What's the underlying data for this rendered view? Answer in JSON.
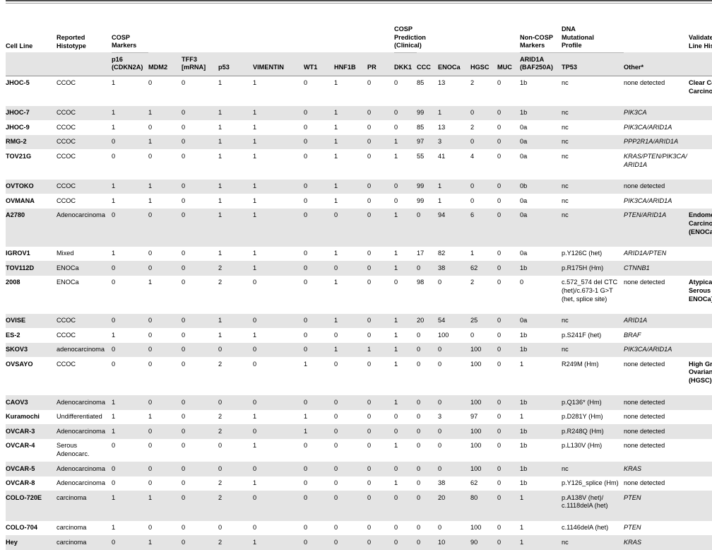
{
  "table": {
    "group_headers": {
      "cell_line": "Cell Line",
      "reported_histotype": "Reported\nHistotype",
      "cosp_markers": "COSP\nMarkers",
      "cosp_prediction": "COSP Prediction\n(Clinical)",
      "non_cosp_markers": "Non-COSP\nMarkers",
      "dna_mutational_profile": "DNA\nMutational\nProfile",
      "validated_histotype": "Validated Cell\nLine HistoType"
    },
    "sub_headers": {
      "p16": "p16\n(CDKN2A)",
      "mdm2": "MDM2",
      "tff3": "TFF3\n[mRNA]",
      "p53": "p53",
      "vimentin": "VIMENTIN",
      "wt1": "WT1",
      "hnf1b": "HNF1B",
      "pr": "PR",
      "dkk1": "DKK1",
      "ccc": "CCC",
      "enoca": "ENOCa",
      "hgsc": "HGSC",
      "muc": "MUC",
      "arid1a": "ARID1A\n(BAF250A)",
      "tp53": "TP53",
      "other": "Other*"
    },
    "rows": [
      {
        "cell_line": "JHOC-5",
        "histotype": "CCOC",
        "p16": "1",
        "mdm2": "0",
        "tff3": "0",
        "p53": "1",
        "vimentin": "1",
        "wt1": "0",
        "hnf1b": "1",
        "pr": "0",
        "dkk1": "0",
        "ccc": "85",
        "enoca": "13",
        "hgsc": "2",
        "muc": "0",
        "arid1a": "1b",
        "tp53": "nc",
        "other": "none detected",
        "other_italic": false,
        "validated": "Clear Cell Carcinoma (CCC)",
        "shaded": false,
        "tall": true
      },
      {
        "cell_line": "JHOC-7",
        "histotype": "CCOC",
        "p16": "1",
        "mdm2": "1",
        "tff3": "0",
        "p53": "1",
        "vimentin": "1",
        "wt1": "0",
        "hnf1b": "1",
        "pr": "0",
        "dkk1": "0",
        "ccc": "99",
        "enoca": "1",
        "hgsc": "0",
        "muc": "0",
        "arid1a": "1b",
        "tp53": "nc",
        "other": "PIK3CA",
        "other_italic": true,
        "validated": "",
        "shaded": true,
        "tall": false
      },
      {
        "cell_line": "JHOC-9",
        "histotype": "CCOC",
        "p16": "1",
        "mdm2": "0",
        "tff3": "0",
        "p53": "1",
        "vimentin": "1",
        "wt1": "0",
        "hnf1b": "1",
        "pr": "0",
        "dkk1": "0",
        "ccc": "85",
        "enoca": "13",
        "hgsc": "2",
        "muc": "0",
        "arid1a": "0a",
        "tp53": "nc",
        "other": "PIK3CA/ARID1A",
        "other_italic": true,
        "validated": "",
        "shaded": false,
        "tall": false
      },
      {
        "cell_line": "RMG-2",
        "histotype": "CCOC",
        "p16": "0",
        "mdm2": "1",
        "tff3": "0",
        "p53": "1",
        "vimentin": "1",
        "wt1": "0",
        "hnf1b": "1",
        "pr": "0",
        "dkk1": "1",
        "ccc": "97",
        "enoca": "3",
        "hgsc": "0",
        "muc": "0",
        "arid1a": "0a",
        "tp53": "nc",
        "other": "PPP2R1A/ARID1A",
        "other_italic": true,
        "validated": "",
        "shaded": true,
        "tall": false
      },
      {
        "cell_line": "TOV21G",
        "histotype": "CCOC",
        "p16": "0",
        "mdm2": "0",
        "tff3": "0",
        "p53": "1",
        "vimentin": "1",
        "wt1": "0",
        "hnf1b": "1",
        "pr": "0",
        "dkk1": "1",
        "ccc": "55",
        "enoca": "41",
        "hgsc": "4",
        "muc": "0",
        "arid1a": "0a",
        "tp53": "nc",
        "other": "KRAS/PTEN/PIK3CA/ ARID1A",
        "other_italic": true,
        "validated": "",
        "shaded": false,
        "tall": true
      },
      {
        "cell_line": "OVTOKO",
        "histotype": "CCOC",
        "p16": "1",
        "mdm2": "1",
        "tff3": "0",
        "p53": "1",
        "vimentin": "1",
        "wt1": "0",
        "hnf1b": "1",
        "pr": "0",
        "dkk1": "0",
        "ccc": "99",
        "enoca": "1",
        "hgsc": "0",
        "muc": "0",
        "arid1a": "0b",
        "tp53": "nc",
        "other": "none detected",
        "other_italic": false,
        "validated": "",
        "shaded": true,
        "tall": false
      },
      {
        "cell_line": "OVMANA",
        "histotype": "CCOC",
        "p16": "1",
        "mdm2": "1",
        "tff3": "0",
        "p53": "1",
        "vimentin": "1",
        "wt1": "0",
        "hnf1b": "1",
        "pr": "0",
        "dkk1": "0",
        "ccc": "99",
        "enoca": "1",
        "hgsc": "0",
        "muc": "0",
        "arid1a": "0a",
        "tp53": "nc",
        "other": "PIK3CA/ARID1A",
        "other_italic": true,
        "validated": "",
        "shaded": false,
        "tall": false
      },
      {
        "cell_line": "A2780",
        "histotype": "Adenocarcinoma",
        "p16": "0",
        "mdm2": "0",
        "tff3": "0",
        "p53": "1",
        "vimentin": "1",
        "wt1": "0",
        "hnf1b": "0",
        "pr": "0",
        "dkk1": "1",
        "ccc": "0",
        "enoca": "94",
        "hgsc": "6",
        "muc": "0",
        "arid1a": "0a",
        "tp53": "nc",
        "other": "PTEN/ARID1A",
        "other_italic": true,
        "validated": "Endometrioid Carcinoma (ENOCa)",
        "shaded": true,
        "tall": true
      },
      {
        "cell_line": "IGROV1",
        "histotype": "Mixed",
        "p16": "1",
        "mdm2": "0",
        "tff3": "0",
        "p53": "1",
        "vimentin": "1",
        "wt1": "0",
        "hnf1b": "1",
        "pr": "0",
        "dkk1": "1",
        "ccc": "17",
        "enoca": "82",
        "hgsc": "1",
        "muc": "0",
        "arid1a": "0a",
        "tp53": "p.Y126C (het)",
        "other": "ARID1A/PTEN",
        "other_italic": true,
        "validated": "",
        "shaded": false,
        "tall": false
      },
      {
        "cell_line": "TOV112D",
        "histotype": "ENOCa",
        "p16": "0",
        "mdm2": "0",
        "tff3": "0",
        "p53": "2",
        "vimentin": "1",
        "wt1": "0",
        "hnf1b": "0",
        "pr": "0",
        "dkk1": "1",
        "ccc": "0",
        "enoca": "38",
        "hgsc": "62",
        "muc": "0",
        "arid1a": "1b",
        "tp53": "p.R175H (Hm)",
        "other": "CTNNB1",
        "other_italic": true,
        "validated": "",
        "shaded": true,
        "tall": false
      },
      {
        "cell_line": "2008",
        "histotype": "ENOCa",
        "p16": "0",
        "mdm2": "1",
        "tff3": "0",
        "p53": "2",
        "vimentin": "0",
        "wt1": "0",
        "hnf1b": "1",
        "pr": "0",
        "dkk1": "0",
        "ccc": "98",
        "enoca": "0",
        "hgsc": "2",
        "muc": "0",
        "arid1a": "0",
        "tp53": "c.572_574 del CTC (het)/c.673-1 G>T (het, splice site)",
        "other": "none detected",
        "other_italic": false,
        "validated": "Atypical Non-Serous [CCC/ ENOCa] cell lines**",
        "shaded": false,
        "tall": true
      },
      {
        "cell_line": "OVISE",
        "histotype": "CCOC",
        "p16": "0",
        "mdm2": "0",
        "tff3": "0",
        "p53": "1",
        "vimentin": "0",
        "wt1": "0",
        "hnf1b": "1",
        "pr": "0",
        "dkk1": "1",
        "ccc": "20",
        "enoca": "54",
        "hgsc": "25",
        "muc": "0",
        "arid1a": "0a",
        "tp53": "nc",
        "other": "ARID1A",
        "other_italic": true,
        "validated": "",
        "shaded": true,
        "tall": false
      },
      {
        "cell_line": "ES-2",
        "histotype": "CCOC",
        "p16": "1",
        "mdm2": "0",
        "tff3": "0",
        "p53": "1",
        "vimentin": "1",
        "wt1": "0",
        "hnf1b": "0",
        "pr": "0",
        "dkk1": "1",
        "ccc": "0",
        "enoca": "100",
        "hgsc": "0",
        "muc": "0",
        "arid1a": "1b",
        "tp53": "p.S241F (het)",
        "other": "BRAF",
        "other_italic": true,
        "validated": "",
        "shaded": false,
        "tall": false
      },
      {
        "cell_line": "SKOV3",
        "histotype": "adenocarcinoma",
        "p16": "0",
        "mdm2": "0",
        "tff3": "0",
        "p53": "0",
        "vimentin": "0",
        "wt1": "0",
        "hnf1b": "1",
        "pr": "1",
        "dkk1": "1",
        "ccc": "0",
        "enoca": "0",
        "hgsc": "100",
        "muc": "0",
        "arid1a": "1b",
        "tp53": "nc",
        "other": "PIK3CA/ARID1A",
        "other_italic": true,
        "validated": "",
        "shaded": true,
        "tall": false
      },
      {
        "cell_line": "OVSAYO",
        "histotype": "CCOC",
        "p16": "0",
        "mdm2": "0",
        "tff3": "0",
        "p53": "2",
        "vimentin": "0",
        "wt1": "1",
        "hnf1b": "0",
        "pr": "0",
        "dkk1": "1",
        "ccc": "0",
        "enoca": "0",
        "hgsc": "100",
        "muc": "0",
        "arid1a": "1",
        "tp53": "R249M (Hm)",
        "other": "none detected",
        "other_italic": false,
        "validated": "High Grade Serous Ovarian Carcinoma (HGSC)",
        "shaded": false,
        "tall": true
      },
      {
        "cell_line": "CAOV3",
        "histotype": "Adenocarcinoma",
        "p16": "1",
        "mdm2": "0",
        "tff3": "0",
        "p53": "0",
        "vimentin": "0",
        "wt1": "0",
        "hnf1b": "0",
        "pr": "0",
        "dkk1": "1",
        "ccc": "0",
        "enoca": "0",
        "hgsc": "100",
        "muc": "0",
        "arid1a": "1b",
        "tp53": "p.Q136* (Hm)",
        "other": "none detected",
        "other_italic": false,
        "validated": "",
        "shaded": true,
        "tall": false
      },
      {
        "cell_line": "Kuramochi",
        "histotype": "Undifferentiated",
        "p16": "1",
        "mdm2": "1",
        "tff3": "0",
        "p53": "2",
        "vimentin": "1",
        "wt1": "1",
        "hnf1b": "0",
        "pr": "0",
        "dkk1": "0",
        "ccc": "0",
        "enoca": "3",
        "hgsc": "97",
        "muc": "0",
        "arid1a": "1",
        "tp53": "p.D281Y (Hm)",
        "other": "none detected",
        "other_italic": false,
        "validated": "",
        "shaded": false,
        "tall": false
      },
      {
        "cell_line": "OVCAR-3",
        "histotype": "Adenocarcinoma",
        "p16": "1",
        "mdm2": "0",
        "tff3": "0",
        "p53": "2",
        "vimentin": "0",
        "wt1": "1",
        "hnf1b": "0",
        "pr": "0",
        "dkk1": "0",
        "ccc": "0",
        "enoca": "0",
        "hgsc": "100",
        "muc": "0",
        "arid1a": "1b",
        "tp53": "p.R248Q (Hm)",
        "other": "none detected",
        "other_italic": false,
        "validated": "",
        "shaded": true,
        "tall": false
      },
      {
        "cell_line": "OVCAR-4",
        "histotype": "Serous Adenocarc.",
        "p16": "0",
        "mdm2": "0",
        "tff3": "0",
        "p53": "0",
        "vimentin": "1",
        "wt1": "0",
        "hnf1b": "0",
        "pr": "0",
        "dkk1": "1",
        "ccc": "0",
        "enoca": "0",
        "hgsc": "100",
        "muc": "0",
        "arid1a": "1b",
        "tp53": "p.L130V (Hm)",
        "other": "none detected",
        "other_italic": false,
        "validated": "",
        "shaded": false,
        "tall": false
      },
      {
        "cell_line": "OVCAR-5",
        "histotype": "Adenocarcinoma",
        "p16": "0",
        "mdm2": "0",
        "tff3": "0",
        "p53": "0",
        "vimentin": "0",
        "wt1": "0",
        "hnf1b": "0",
        "pr": "0",
        "dkk1": "0",
        "ccc": "0",
        "enoca": "0",
        "hgsc": "100",
        "muc": "0",
        "arid1a": "1b",
        "tp53": "nc",
        "other": "KRAS",
        "other_italic": true,
        "validated": "",
        "shaded": true,
        "tall": false
      },
      {
        "cell_line": "OVCAR-8",
        "histotype": "Adenocarcinoma",
        "p16": "0",
        "mdm2": "0",
        "tff3": "0",
        "p53": "2",
        "vimentin": "1",
        "wt1": "0",
        "hnf1b": "0",
        "pr": "0",
        "dkk1": "1",
        "ccc": "0",
        "enoca": "38",
        "hgsc": "62",
        "muc": "0",
        "arid1a": "1b",
        "tp53": "p.Y126_splice (Hm)",
        "other": "none detected",
        "other_italic": false,
        "validated": "",
        "shaded": false,
        "tall": false
      },
      {
        "cell_line": "COLO-720E",
        "histotype": "carcinoma",
        "p16": "1",
        "mdm2": "1",
        "tff3": "0",
        "p53": "2",
        "vimentin": "0",
        "wt1": "0",
        "hnf1b": "0",
        "pr": "0",
        "dkk1": "0",
        "ccc": "0",
        "enoca": "20",
        "hgsc": "80",
        "muc": "0",
        "arid1a": "1",
        "tp53": "p.A138V (het)/ c.1118delA (het)",
        "other": "PTEN",
        "other_italic": true,
        "validated": "",
        "shaded": true,
        "tall": true
      },
      {
        "cell_line": "COLO-704",
        "histotype": "carcinoma",
        "p16": "1",
        "mdm2": "0",
        "tff3": "0",
        "p53": "0",
        "vimentin": "0",
        "wt1": "0",
        "hnf1b": "0",
        "pr": "0",
        "dkk1": "0",
        "ccc": "0",
        "enoca": "0",
        "hgsc": "100",
        "muc": "0",
        "arid1a": "1",
        "tp53": "c.1146delA (het)",
        "other": "PTEN",
        "other_italic": true,
        "validated": "",
        "shaded": false,
        "tall": false
      },
      {
        "cell_line": "Hey",
        "histotype": "carcinoma",
        "p16": "0",
        "mdm2": "1",
        "tff3": "0",
        "p53": "2",
        "vimentin": "1",
        "wt1": "0",
        "hnf1b": "0",
        "pr": "0",
        "dkk1": "0",
        "ccc": "0",
        "enoca": "10",
        "hgsc": "90",
        "muc": "0",
        "arid1a": "1",
        "tp53": "nc",
        "other": "KRAS",
        "other_italic": true,
        "validated": "",
        "shaded": true,
        "tall": false
      }
    ]
  }
}
